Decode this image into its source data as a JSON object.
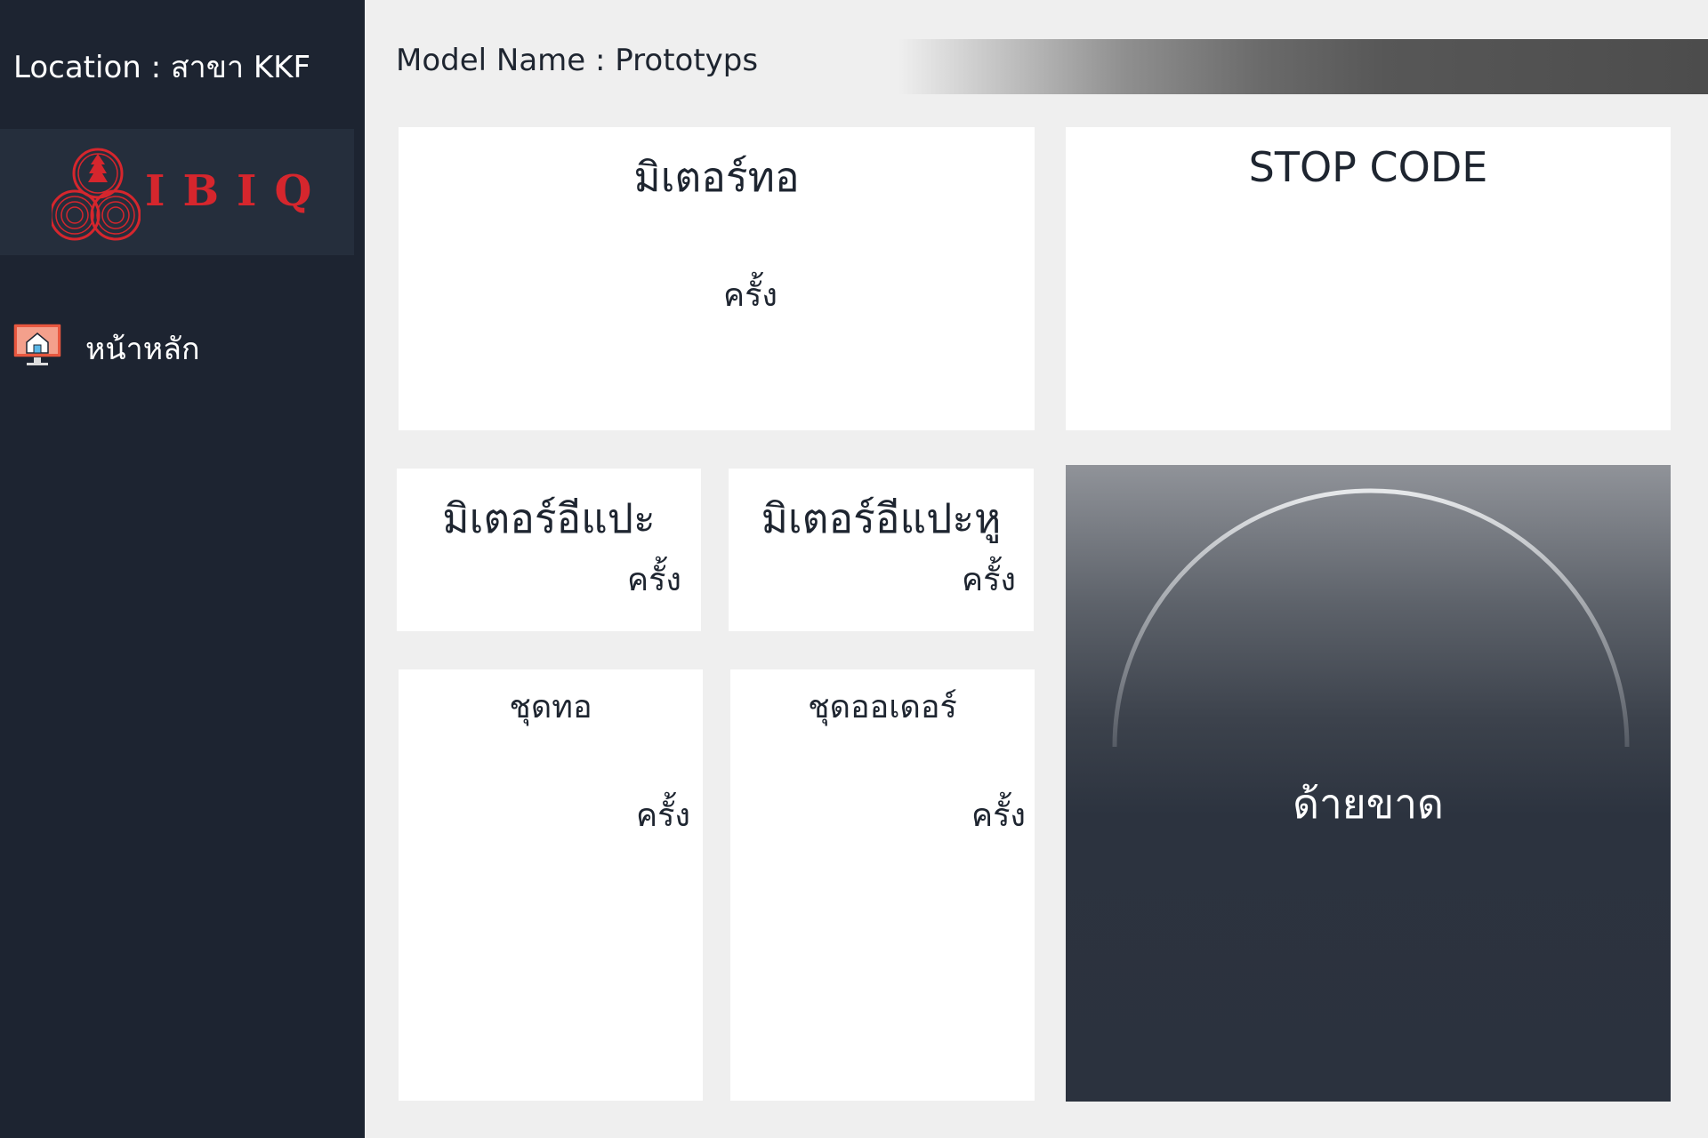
{
  "sidebar": {
    "location": "Location : สาขา KKF",
    "logo_text": "IBIQ",
    "nav_items": [
      {
        "label": "หน้าหลัก",
        "icon": "home-monitor-icon"
      }
    ]
  },
  "header": {
    "model_name": "Model Name : Prototyps"
  },
  "cards": {
    "meter_pipe": {
      "title": "มิเตอร์ทอ",
      "unit": "ครั้ง"
    },
    "stop_code": {
      "title": "STOP CODE"
    },
    "meter_a": {
      "title": "มิเตอร์อีแปะ",
      "unit": "ครั้ง"
    },
    "meter_b": {
      "title": "มิเตอร์อีแปะหู",
      "unit": "ครั้ง"
    },
    "set_pipe": {
      "title": "ชุดทอ",
      "unit": "ครั้ง"
    },
    "set_order": {
      "title": "ชุดออเดอร์",
      "unit": "ครั้ง"
    }
  },
  "gauge": {
    "label": "ด้ายขาด"
  },
  "colors": {
    "sidebar_bg": "#1d2431",
    "logo_box_bg": "#252e3c",
    "brand_red": "#d6262d",
    "page_bg": "#efefef",
    "card_bg": "#ffffff",
    "gauge_bottom": "#2b323e"
  }
}
